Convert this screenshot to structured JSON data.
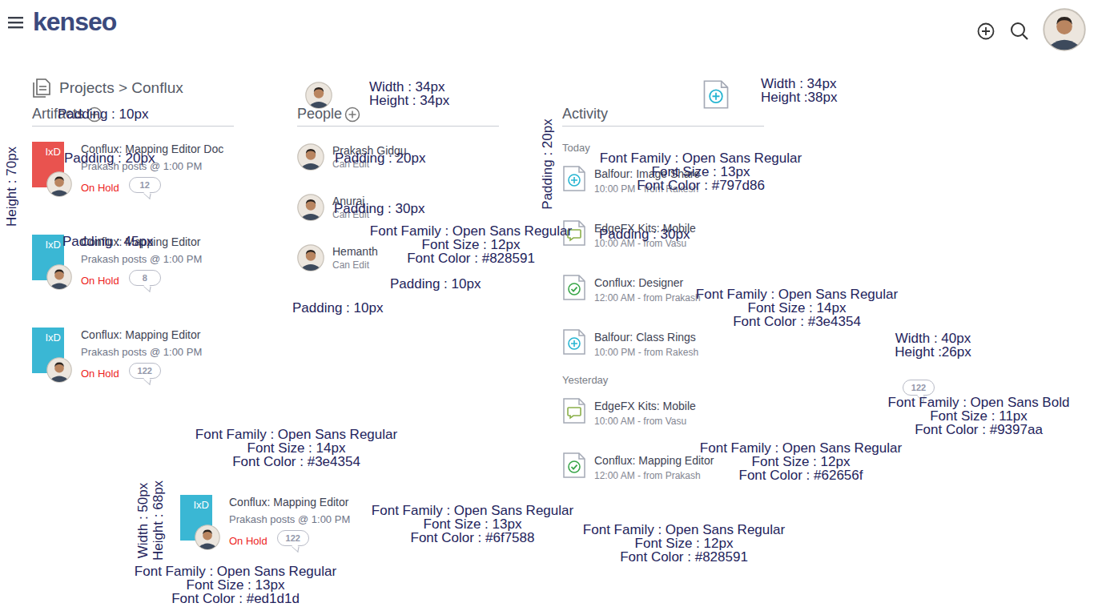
{
  "header": {
    "logo": "kenseo"
  },
  "breadcrumb": {
    "text": "Projects > Conflux"
  },
  "artifacts": {
    "title": "Artifacts",
    "items": [
      {
        "tag": "IxD",
        "title": "Conflux: Mapping Editor Doc",
        "meta": "Prakash posts @ 1:00 PM",
        "status": "On Hold",
        "count": "12",
        "color": "#e9534f"
      },
      {
        "tag": "IxD",
        "title": "Conflux: Mapping Editor",
        "meta": "Prakash posts @ 1:00 PM",
        "status": "On Hold",
        "count": "8",
        "color": "#3ab7d4"
      },
      {
        "tag": "IxD",
        "title": "Conflux: Mapping Editor",
        "meta": "Prakash posts @ 1:00 PM",
        "status": "On Hold",
        "count": "122",
        "color": "#3ab7d4"
      }
    ]
  },
  "people": {
    "title": "People",
    "items": [
      {
        "name": "Prakash Gidgu",
        "role": "Can Edit"
      },
      {
        "name": "Anuraj",
        "role": "Can Edit"
      },
      {
        "name": "Hemanth",
        "role": "Can Edit"
      }
    ]
  },
  "activity": {
    "title": "Activity",
    "groups": [
      {
        "label": "Today",
        "items": [
          {
            "kind": "plus",
            "title": "Balfour: Image Share",
            "meta": "10:00 PM - from Rakesh"
          },
          {
            "kind": "comment",
            "title": "EdgeFX Kits: Mobile",
            "meta": "10:00 AM - from Vasu"
          },
          {
            "kind": "check",
            "title": "Conflux: Designer",
            "meta": "12:00 AM - from Prakash"
          },
          {
            "kind": "plus",
            "title": "Balfour: Class Rings",
            "meta": "10:00 PM - from Rakesh"
          }
        ]
      },
      {
        "label": "Yesterday",
        "items": [
          {
            "kind": "comment",
            "title": "EdgeFX Kits: Mobile",
            "meta": "10:00 AM - from Vasu"
          },
          {
            "kind": "check",
            "title": "Conflux: Mapping Editor",
            "meta": "12:00 AM - from Prakash"
          }
        ]
      }
    ]
  },
  "samples": {
    "badge": "122",
    "artifact": {
      "tag": "IxD",
      "title": "Conflux: Mapping Editor",
      "meta": "Prakash posts @ 1:00 PM",
      "status": "On Hold",
      "count": "122",
      "color": "#3ab7d4"
    }
  },
  "annotations": [
    {
      "lines": [
        "Padding : 10px"
      ]
    },
    {
      "lines": [
        "Height : 70px"
      ]
    },
    {
      "lines": [
        "Padding : 20px"
      ]
    },
    {
      "lines": [
        "Padding : 45px"
      ]
    },
    {
      "lines": [
        "Width : 34px",
        "Height : 34px"
      ]
    },
    {
      "lines": [
        "Padding : 20px"
      ]
    },
    {
      "lines": [
        "Padding : 30px"
      ]
    },
    {
      "lines": [
        "Font Family : Open Sans Regular",
        "Font Size : 12px",
        "Font Color : #828591"
      ]
    },
    {
      "lines": [
        "Padding : 10px"
      ]
    },
    {
      "lines": [
        "Padding : 10px"
      ]
    },
    {
      "lines": [
        "Width : 34px",
        "Height :38px"
      ]
    },
    {
      "lines": [
        "Padding : 20px"
      ]
    },
    {
      "lines": [
        "Font Family : Open Sans Regular",
        "Font Size : 13px",
        "Font Color : #797d86"
      ]
    },
    {
      "lines": [
        "Padding : 30px"
      ]
    },
    {
      "lines": [
        "Font Family : Open Sans Regular",
        "Font Size : 14px",
        "Font Color : #3e4354"
      ]
    },
    {
      "lines": [
        "Width : 40px",
        "Height :26px"
      ]
    },
    {
      "lines": [
        "Font Family : Open Sans Bold",
        "Font Size : 11px",
        "Font Color : #9397aa"
      ]
    },
    {
      "lines": [
        "Font Family : Open Sans Regular",
        "Font Size : 12px",
        "Font Color : #62656f"
      ]
    },
    {
      "lines": [
        "Font Family : Open Sans Regular",
        "Font Size : 12px",
        "Font Color : #828591"
      ]
    },
    {
      "lines": [
        "Font Family : Open Sans Regular",
        "Font Size : 14px",
        "Font Color : #3e4354"
      ]
    },
    {
      "lines": [
        "Font Family : Open Sans Regular",
        "Font Size : 13px",
        "Font Color : #6f7588"
      ]
    },
    {
      "lines": [
        "Font Family : Open Sans Regular",
        "Font Size : 13px",
        "Font Color : #ed1d1d"
      ]
    },
    {
      "lines": [
        "Width : 50px"
      ]
    },
    {
      "lines": [
        "Height : 68px"
      ]
    }
  ]
}
